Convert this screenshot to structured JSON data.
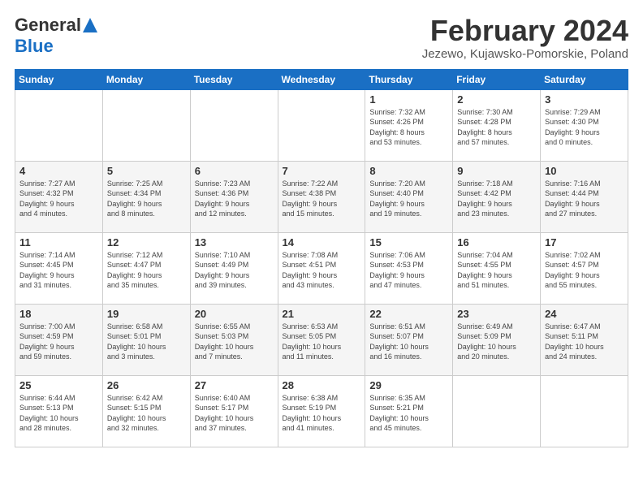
{
  "logo": {
    "general": "General",
    "blue": "Blue"
  },
  "title": "February 2024",
  "subtitle": "Jezewo, Kujawsko-Pomorskie, Poland",
  "weekdays": [
    "Sunday",
    "Monday",
    "Tuesday",
    "Wednesday",
    "Thursday",
    "Friday",
    "Saturday"
  ],
  "weeks": [
    [
      {
        "day": "",
        "info": ""
      },
      {
        "day": "",
        "info": ""
      },
      {
        "day": "",
        "info": ""
      },
      {
        "day": "",
        "info": ""
      },
      {
        "day": "1",
        "info": "Sunrise: 7:32 AM\nSunset: 4:26 PM\nDaylight: 8 hours\nand 53 minutes."
      },
      {
        "day": "2",
        "info": "Sunrise: 7:30 AM\nSunset: 4:28 PM\nDaylight: 8 hours\nand 57 minutes."
      },
      {
        "day": "3",
        "info": "Sunrise: 7:29 AM\nSunset: 4:30 PM\nDaylight: 9 hours\nand 0 minutes."
      }
    ],
    [
      {
        "day": "4",
        "info": "Sunrise: 7:27 AM\nSunset: 4:32 PM\nDaylight: 9 hours\nand 4 minutes."
      },
      {
        "day": "5",
        "info": "Sunrise: 7:25 AM\nSunset: 4:34 PM\nDaylight: 9 hours\nand 8 minutes."
      },
      {
        "day": "6",
        "info": "Sunrise: 7:23 AM\nSunset: 4:36 PM\nDaylight: 9 hours\nand 12 minutes."
      },
      {
        "day": "7",
        "info": "Sunrise: 7:22 AM\nSunset: 4:38 PM\nDaylight: 9 hours\nand 15 minutes."
      },
      {
        "day": "8",
        "info": "Sunrise: 7:20 AM\nSunset: 4:40 PM\nDaylight: 9 hours\nand 19 minutes."
      },
      {
        "day": "9",
        "info": "Sunrise: 7:18 AM\nSunset: 4:42 PM\nDaylight: 9 hours\nand 23 minutes."
      },
      {
        "day": "10",
        "info": "Sunrise: 7:16 AM\nSunset: 4:44 PM\nDaylight: 9 hours\nand 27 minutes."
      }
    ],
    [
      {
        "day": "11",
        "info": "Sunrise: 7:14 AM\nSunset: 4:45 PM\nDaylight: 9 hours\nand 31 minutes."
      },
      {
        "day": "12",
        "info": "Sunrise: 7:12 AM\nSunset: 4:47 PM\nDaylight: 9 hours\nand 35 minutes."
      },
      {
        "day": "13",
        "info": "Sunrise: 7:10 AM\nSunset: 4:49 PM\nDaylight: 9 hours\nand 39 minutes."
      },
      {
        "day": "14",
        "info": "Sunrise: 7:08 AM\nSunset: 4:51 PM\nDaylight: 9 hours\nand 43 minutes."
      },
      {
        "day": "15",
        "info": "Sunrise: 7:06 AM\nSunset: 4:53 PM\nDaylight: 9 hours\nand 47 minutes."
      },
      {
        "day": "16",
        "info": "Sunrise: 7:04 AM\nSunset: 4:55 PM\nDaylight: 9 hours\nand 51 minutes."
      },
      {
        "day": "17",
        "info": "Sunrise: 7:02 AM\nSunset: 4:57 PM\nDaylight: 9 hours\nand 55 minutes."
      }
    ],
    [
      {
        "day": "18",
        "info": "Sunrise: 7:00 AM\nSunset: 4:59 PM\nDaylight: 9 hours\nand 59 minutes."
      },
      {
        "day": "19",
        "info": "Sunrise: 6:58 AM\nSunset: 5:01 PM\nDaylight: 10 hours\nand 3 minutes."
      },
      {
        "day": "20",
        "info": "Sunrise: 6:55 AM\nSunset: 5:03 PM\nDaylight: 10 hours\nand 7 minutes."
      },
      {
        "day": "21",
        "info": "Sunrise: 6:53 AM\nSunset: 5:05 PM\nDaylight: 10 hours\nand 11 minutes."
      },
      {
        "day": "22",
        "info": "Sunrise: 6:51 AM\nSunset: 5:07 PM\nDaylight: 10 hours\nand 16 minutes."
      },
      {
        "day": "23",
        "info": "Sunrise: 6:49 AM\nSunset: 5:09 PM\nDaylight: 10 hours\nand 20 minutes."
      },
      {
        "day": "24",
        "info": "Sunrise: 6:47 AM\nSunset: 5:11 PM\nDaylight: 10 hours\nand 24 minutes."
      }
    ],
    [
      {
        "day": "25",
        "info": "Sunrise: 6:44 AM\nSunset: 5:13 PM\nDaylight: 10 hours\nand 28 minutes."
      },
      {
        "day": "26",
        "info": "Sunrise: 6:42 AM\nSunset: 5:15 PM\nDaylight: 10 hours\nand 32 minutes."
      },
      {
        "day": "27",
        "info": "Sunrise: 6:40 AM\nSunset: 5:17 PM\nDaylight: 10 hours\nand 37 minutes."
      },
      {
        "day": "28",
        "info": "Sunrise: 6:38 AM\nSunset: 5:19 PM\nDaylight: 10 hours\nand 41 minutes."
      },
      {
        "day": "29",
        "info": "Sunrise: 6:35 AM\nSunset: 5:21 PM\nDaylight: 10 hours\nand 45 minutes."
      },
      {
        "day": "",
        "info": ""
      },
      {
        "day": "",
        "info": ""
      }
    ]
  ]
}
